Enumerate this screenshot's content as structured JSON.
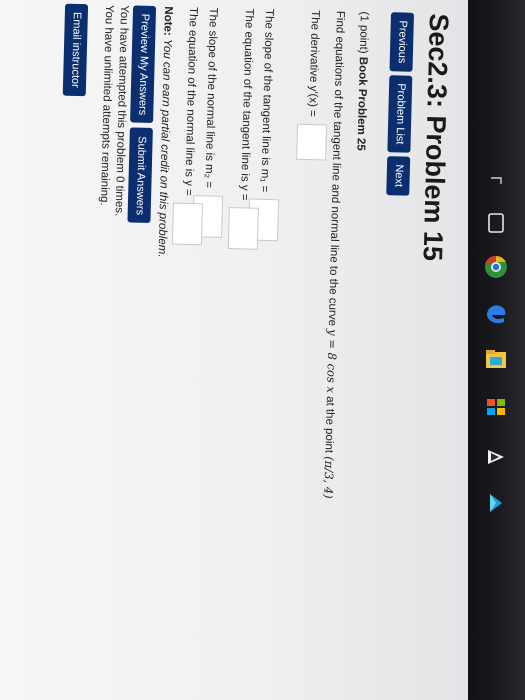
{
  "page": {
    "title": "Sec2.3: Problem 15",
    "nav": {
      "previous": "Previous",
      "problem_list": "Problem List",
      "next": "Next"
    },
    "points": "(1 point)",
    "book_problem": "Book Problem 25",
    "instruction_pre": "Find equations of the tangent line and normal line to the curve",
    "curve": "y = 8 cos x",
    "instruction_mid": "at the point",
    "point": "(π/3, 4)",
    "derivative_label": "The derivative y′(x) =",
    "slope_tangent_label": "The slope of the tangent line is m₁ =",
    "eq_tangent_label": "The equation of the tangent line is y =",
    "slope_normal_label": "The slope of the normal line is m₂ =",
    "eq_normal_label": "The equation of the normal line is y =",
    "note_label": "Note:",
    "note_text": "You can earn partial credit on this problem.",
    "preview_button": "Preview My Answers",
    "submit_button": "Submit Answers",
    "attempts_text": "You have attempted this problem 0 times.",
    "remaining_text": "You have unlimited attempts remaining.",
    "email_button": "Email instructor"
  },
  "taskbar": {
    "icons": [
      "browser-icon",
      "file-explorer-icon",
      "edge-icon",
      "folder-icon",
      "store-icon",
      "media-player-icon",
      "app-icon"
    ]
  }
}
